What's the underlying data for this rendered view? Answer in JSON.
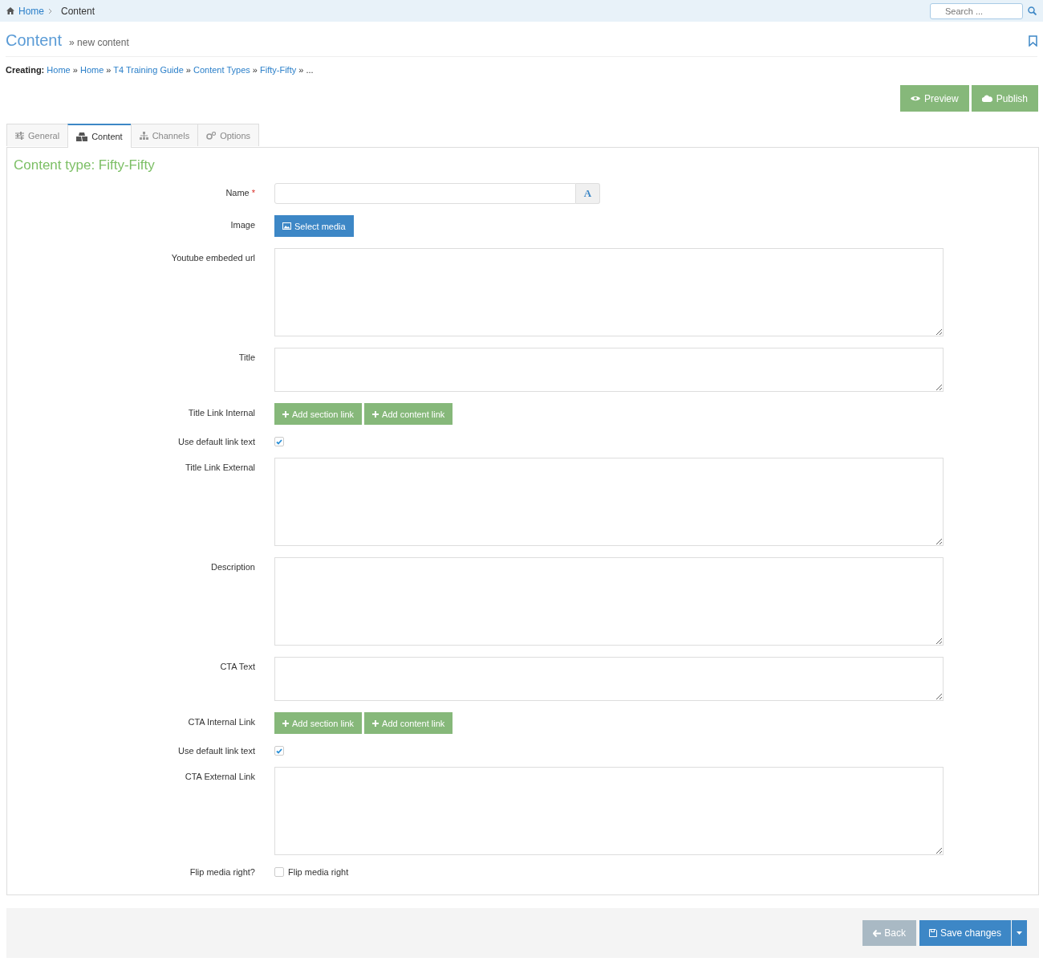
{
  "top_bar": {
    "breadcrumb": [
      {
        "label": "Home",
        "kind": "link"
      },
      {
        "label": "Content",
        "kind": "current"
      }
    ],
    "search": {
      "placeholder": "Search ..."
    }
  },
  "header": {
    "title": "Content",
    "subtitle": "» new content"
  },
  "creating": {
    "label": "Creating:",
    "path": [
      {
        "label": "Home"
      },
      {
        "label": "Home"
      },
      {
        "label": "T4 Training Guide"
      },
      {
        "label": "Content Types"
      },
      {
        "label": "Fifty-Fifty"
      }
    ],
    "separator": "»",
    "ellipsis": "..."
  },
  "actions": [
    {
      "label": "Preview"
    },
    {
      "label": "Publish"
    }
  ],
  "tabs": [
    {
      "label": "General",
      "selected": false
    },
    {
      "label": "Content",
      "selected": true
    },
    {
      "label": "Channels",
      "selected": false
    },
    {
      "label": "Options",
      "selected": false
    }
  ],
  "panel": {
    "heading": "Content type: Fifty-Fifty",
    "fields": [
      {
        "label": "Name",
        "required_mark": "*",
        "kind": "text",
        "addon": "A"
      },
      {
        "label": "Image",
        "kind": "media",
        "button": "Select media"
      },
      {
        "label": "Youtube embeded url",
        "kind": "textarea"
      },
      {
        "label": "Title",
        "kind": "shortarea"
      },
      {
        "label": "Title Link Internal",
        "kind": "links",
        "buttons": [
          "Add section link",
          "Add content link"
        ]
      },
      {
        "label": "Use default link text",
        "kind": "checkbox",
        "checked": true
      },
      {
        "label": "Title Link External",
        "kind": "textarea"
      },
      {
        "label": "Description",
        "kind": "textarea"
      },
      {
        "label": "CTA Text",
        "kind": "shortarea"
      },
      {
        "label": "CTA Internal Link",
        "kind": "links",
        "buttons": [
          "Add section link",
          "Add content link"
        ]
      },
      {
        "label": "Use default link text",
        "kind": "checkbox",
        "checked": true
      },
      {
        "label": "CTA External Link",
        "kind": "textarea"
      },
      {
        "label": "Flip media right?",
        "kind": "checkbox",
        "checked": false,
        "text": "Flip media right"
      }
    ]
  },
  "footer": {
    "back": "Back",
    "save": "Save changes"
  }
}
